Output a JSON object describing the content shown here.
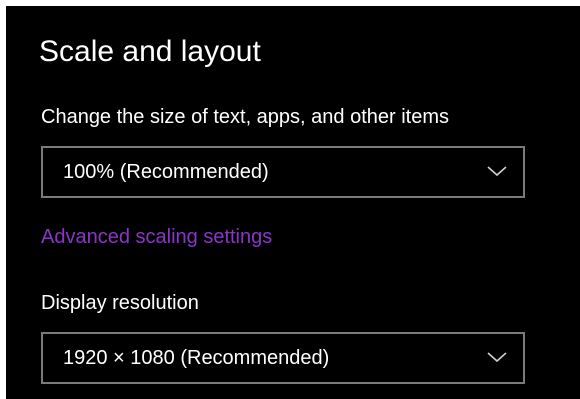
{
  "section": {
    "title": "Scale and layout"
  },
  "scale": {
    "label": "Change the size of text, apps, and other items",
    "selected": "100% (Recommended)",
    "icon": "chevron-down-icon"
  },
  "advanced_link": {
    "label": "Advanced scaling settings",
    "color": "#8a35c9"
  },
  "resolution": {
    "label": "Display resolution",
    "selected": "1920 × 1080 (Recommended)",
    "icon": "chevron-down-icon"
  },
  "colors": {
    "background": "#000000",
    "text": "#ffffff",
    "border": "#7a7a7a"
  }
}
